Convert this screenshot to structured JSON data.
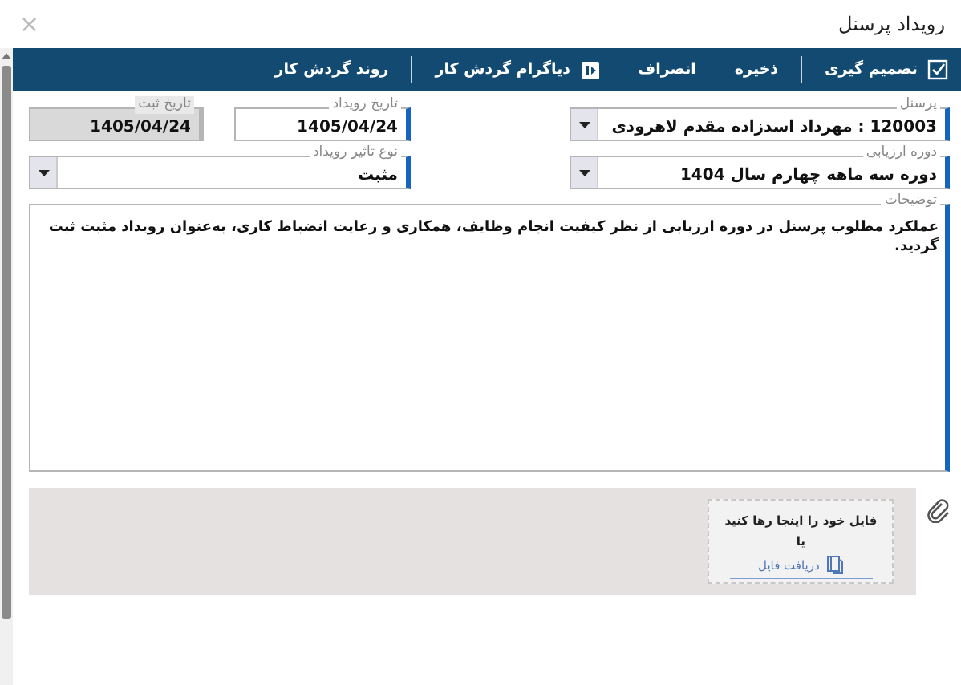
{
  "window": {
    "title": "رویداد پرسنل",
    "close": "×"
  },
  "toolbar": [
    {
      "kind": "check",
      "label": "تصمیم گیری"
    },
    {
      "kind": "separator"
    },
    {
      "kind": "plain",
      "label": "ذخیره"
    },
    {
      "kind": "plain",
      "label": "انصراف"
    },
    {
      "kind": "diagram",
      "label": "دیاگرام گردش کار"
    },
    {
      "kind": "separator"
    },
    {
      "kind": "plain",
      "label": "روند گردش کار"
    }
  ],
  "rows": [
    [
      {
        "kind": "combo",
        "label": "پرسنل",
        "value": "120003 : مهرداد اسدزاده مقدم لاهرودی",
        "disabled": false
      },
      {
        "kind": "date",
        "label": "تاریخ رویداد",
        "value": "1405/04/24",
        "disabled": false
      },
      {
        "kind": "date",
        "label": "تاریخ ثبت",
        "value": "1405/04/24",
        "disabled": true
      }
    ],
    [
      {
        "kind": "combo",
        "label": "دوره ارزیابی",
        "value": "دوره سه ماهه چهارم سال 1404",
        "disabled": false
      },
      {
        "kind": "combo",
        "label": "نوع تاثیر رویداد",
        "value": "مثبت",
        "disabled": false
      }
    ]
  ],
  "description": {
    "label": "توضیحات",
    "value": "عملکرد مطلوب پرسنل در دوره ارزیابی از نظر کیفیت انجام وظایف، همکاری و رعایت انضباط کاری، به‌عنوان رویداد مثبت ثبت گردید."
  },
  "attachment": {
    "drop_text": "فایل خود را اینجا رها کنید",
    "or": "یا",
    "link": "دریافت فایل"
  }
}
